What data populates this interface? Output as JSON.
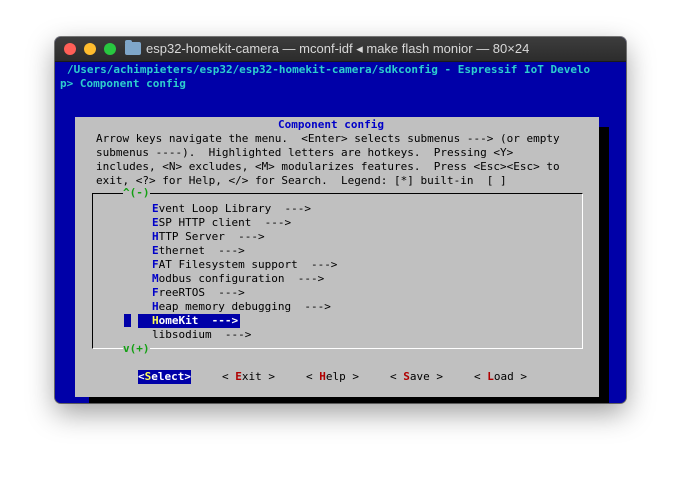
{
  "window": {
    "title": "esp32-homekit-camera — mconf-idf ◂ make flash monior — 80×24"
  },
  "terminal": {
    "header_line1": "/Users/achimpieters/esp32/esp32-homekit-camera/sdkconfig - Espressif IoT Develo",
    "header_line2": "p> Component config"
  },
  "dialog": {
    "title": "Component config",
    "help": [
      "Arrow keys navigate the menu.  <Enter> selects submenus ---> (or empty",
      "submenus ----).  Highlighted letters are hotkeys.  Pressing <Y>",
      "includes, <N> excludes, <M> modularizes features.  Press <Esc><Esc> to",
      "exit, <?> for Help, </> for Search.  Legend: [*] built-in  [ ]"
    ],
    "scroll_up": "^(-)",
    "scroll_down": "v(+)",
    "items": [
      {
        "hot": "E",
        "rest": "vent Loop Library  --->"
      },
      {
        "hot": "E",
        "rest": "SP HTTP client  --->"
      },
      {
        "hot": "H",
        "rest": "TTP Server  --->"
      },
      {
        "hot": "E",
        "rest": "thernet  --->"
      },
      {
        "hot": "F",
        "rest": "AT Filesystem support  --->"
      },
      {
        "hot": "M",
        "rest": "odbus configuration  --->"
      },
      {
        "hot": "F",
        "rest": "reeRTOS  --->"
      },
      {
        "hot": "H",
        "rest": "eap memory debugging  --->"
      },
      {
        "hot": "H",
        "rest": "omeKit  --->"
      },
      {
        "hot": "",
        "rest": "libsodium  --->"
      }
    ],
    "selected_index": 8,
    "buttons": [
      {
        "pre": "<",
        "hot": "S",
        "rest": "elect>"
      },
      {
        "pre": "< ",
        "hot": "E",
        "rest": "xit >"
      },
      {
        "pre": "< ",
        "hot": "H",
        "rest": "elp >"
      },
      {
        "pre": "< ",
        "hot": "S",
        "rest": "ave >"
      },
      {
        "pre": "< ",
        "hot": "L",
        "rest": "oad >"
      }
    ]
  },
  "colors": {
    "terminal_bg": "#0000a8",
    "dialog_bg": "#c0c0c0",
    "selected_bg": "#0000a8",
    "hotkey_menu": "#0000c8",
    "hotkey_button": "#b00000",
    "scroll_indicator": "#12a012",
    "header_text": "#2dcdcd"
  }
}
